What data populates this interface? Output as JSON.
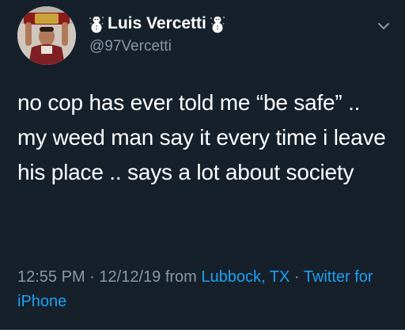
{
  "tweet": {
    "display_name": "Luis Vercetti",
    "handle": "@97Vercetti",
    "text": "no cop has ever told me “be safe” .. my weed man say it every time i leave his place .. says a lot about society",
    "time": "12:55 PM",
    "date": "12/12/19",
    "from_label": "from",
    "location": "Lubbock, TX",
    "separator": "·",
    "source": "Twitter for iPhone"
  },
  "icons": {
    "name_emoji_left": "snowman-icon",
    "name_emoji_right": "snowman-icon",
    "menu": "chevron-down-icon",
    "avatar": "avatar"
  },
  "colors": {
    "background": "#15202b",
    "text": "#ffffff",
    "secondary": "#8899a6",
    "link": "#1da1f2"
  }
}
